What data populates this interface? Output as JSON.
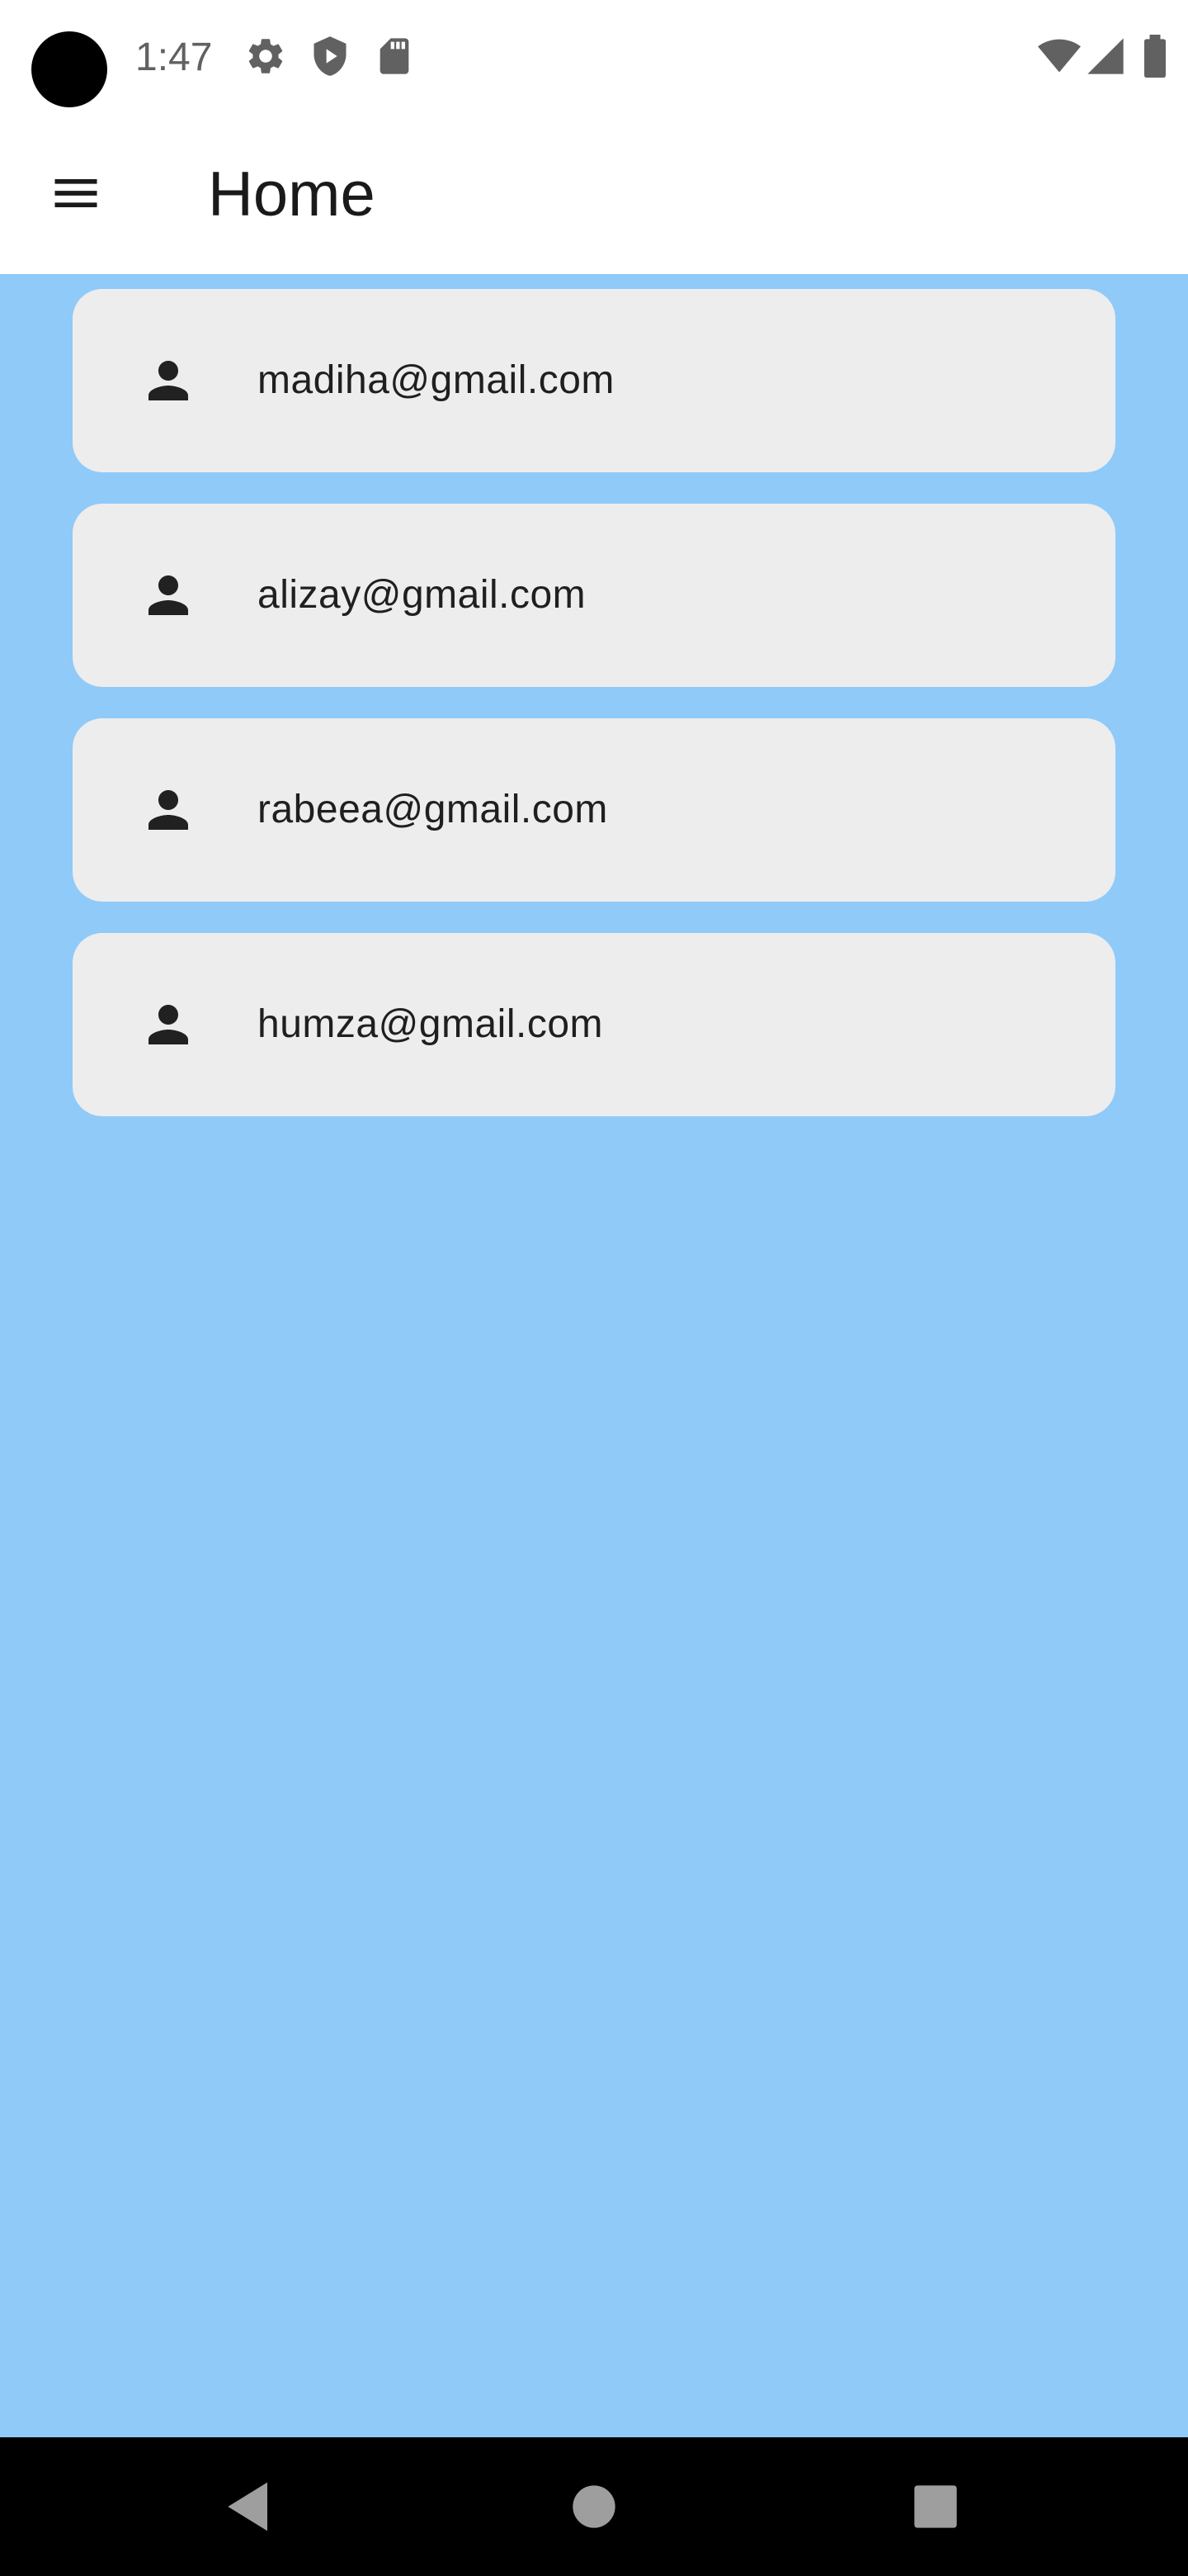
{
  "status_bar": {
    "time": "1:47",
    "icons": [
      "gear-icon",
      "shield-play-icon",
      "sd-card-icon",
      "wifi-icon",
      "cell-signal-icon",
      "battery-icon"
    ]
  },
  "app_bar": {
    "title": "Home",
    "menu_icon": "menu-icon"
  },
  "users": [
    {
      "email": "madiha@gmail.com",
      "icon": "person-icon"
    },
    {
      "email": "alizay@gmail.com",
      "icon": "person-icon"
    },
    {
      "email": "rabeea@gmail.com",
      "icon": "person-icon"
    },
    {
      "email": "humza@gmail.com",
      "icon": "person-icon"
    }
  ],
  "nav_bar": {
    "buttons": [
      "back-icon",
      "home-icon",
      "recents-icon"
    ]
  },
  "colors": {
    "background": "#90CAF9",
    "card": "#EDEDED",
    "app_bar": "#FFFFFF",
    "nav_bar": "#000000"
  }
}
